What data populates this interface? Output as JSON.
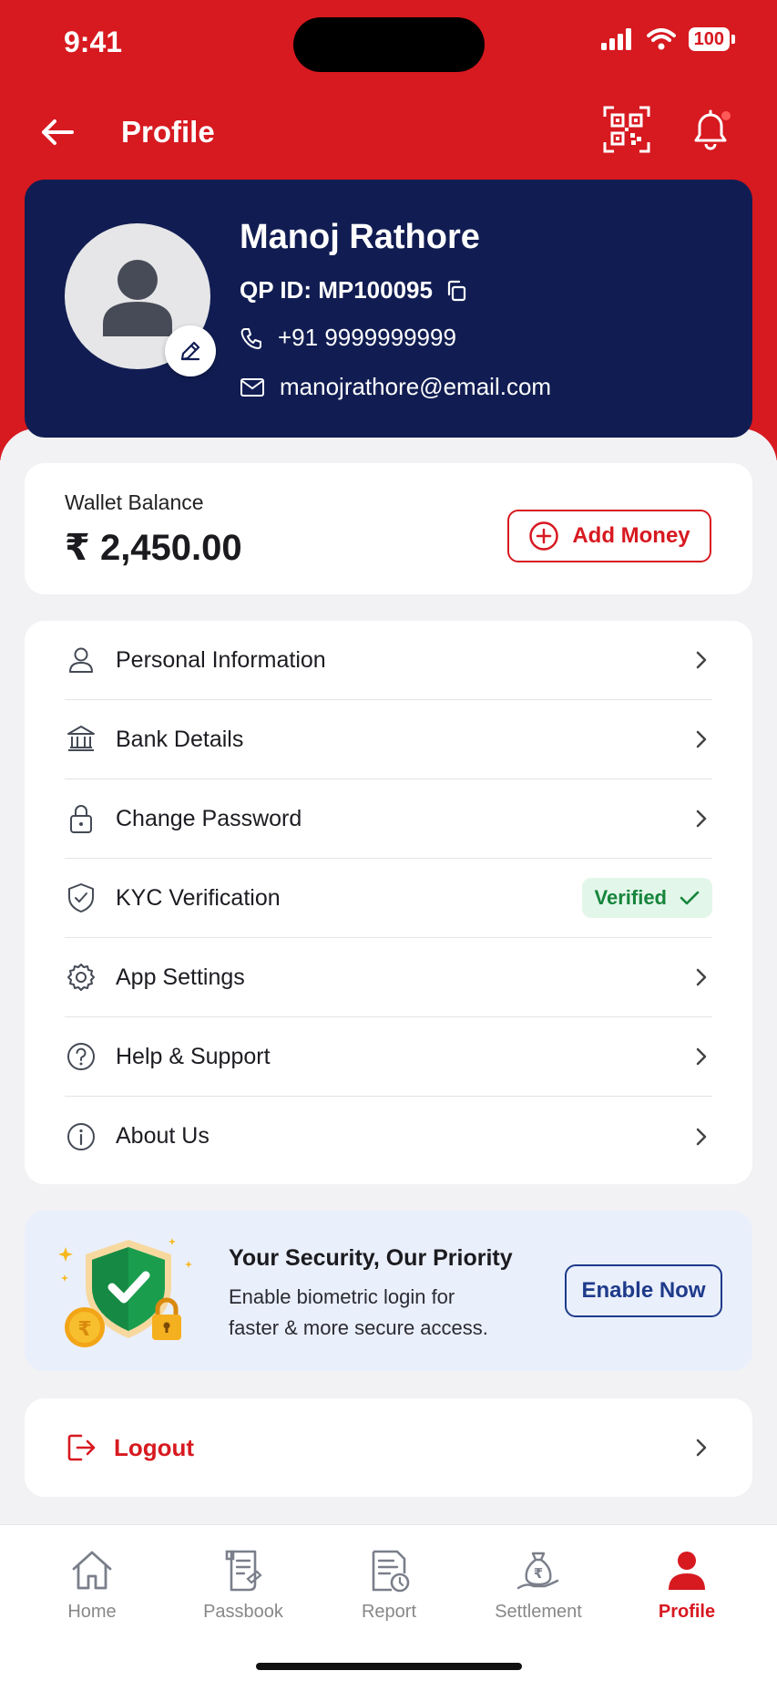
{
  "status_bar": {
    "time": "9:41",
    "battery": "100"
  },
  "app_bar": {
    "title": "Profile"
  },
  "profile": {
    "name": "Manoj Rathore",
    "qp_id": "QP ID: MP100095",
    "phone": "+91 9999999999",
    "email": "manojrathore@email.com"
  },
  "wallet": {
    "label": "Wallet Balance",
    "amount": "₹ 2,450.00",
    "add_money_label": "Add Money"
  },
  "menu": {
    "items": [
      {
        "label": "Personal Information",
        "icon": "user-icon"
      },
      {
        "label": "Bank Details",
        "icon": "bank-icon"
      },
      {
        "label": "Change Password",
        "icon": "lock-icon"
      },
      {
        "label": "KYC Verification",
        "icon": "shield-check-icon",
        "badge": "Verified"
      },
      {
        "label": "App Settings",
        "icon": "gear-icon"
      },
      {
        "label": "Help & Support",
        "icon": "help-icon"
      },
      {
        "label": "About Us",
        "icon": "info-icon"
      }
    ]
  },
  "security": {
    "title": "Your Security, Our Priority",
    "description": "Enable biometric login for faster & more secure access.",
    "button_label": "Enable Now"
  },
  "logout": {
    "label": "Logout"
  },
  "bottom_nav": {
    "items": [
      {
        "label": "Home",
        "icon": "home-icon"
      },
      {
        "label": "Passbook",
        "icon": "passbook-icon"
      },
      {
        "label": "Report",
        "icon": "report-icon"
      },
      {
        "label": "Settlement",
        "icon": "settlement-icon"
      },
      {
        "label": "Profile",
        "icon": "profile-icon",
        "active": true
      }
    ]
  },
  "colors": {
    "brand_red": "#d71920",
    "navy": "#111d52",
    "verified_green": "#16853b",
    "accent_blue": "#1e3a8a"
  }
}
